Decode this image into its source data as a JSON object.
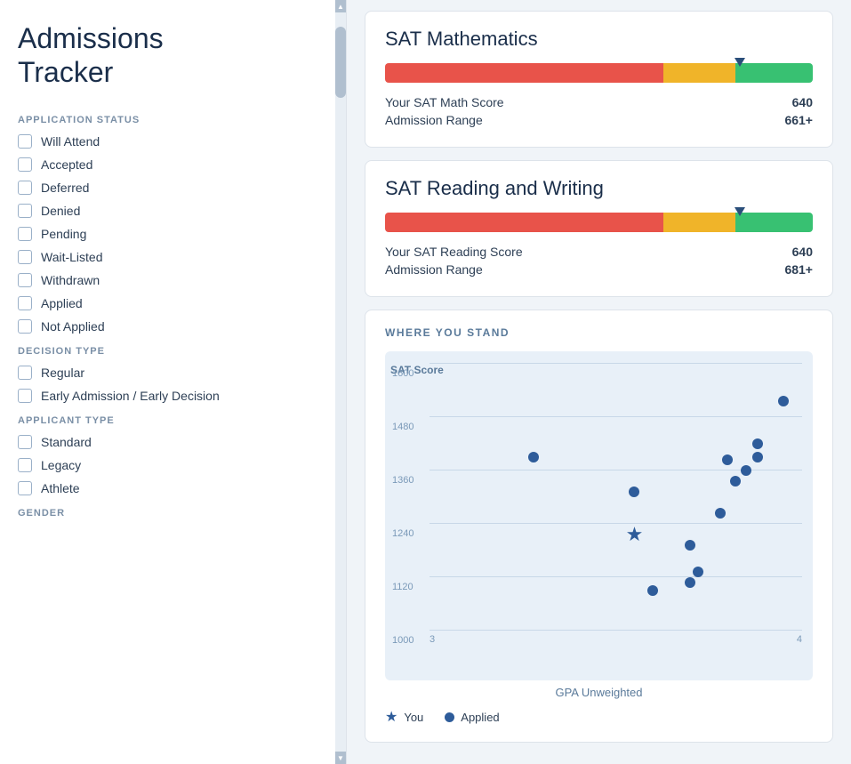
{
  "sidebar": {
    "title": "Admissions\nTracker",
    "sections": [
      {
        "label": "APPLICATION STATUS",
        "items": [
          {
            "id": "will-attend",
            "label": "Will Attend"
          },
          {
            "id": "accepted",
            "label": "Accepted"
          },
          {
            "id": "deferred",
            "label": "Deferred"
          },
          {
            "id": "denied",
            "label": "Denied"
          },
          {
            "id": "pending",
            "label": "Pending"
          },
          {
            "id": "wait-listed",
            "label": "Wait-Listed"
          },
          {
            "id": "withdrawn",
            "label": "Withdrawn"
          },
          {
            "id": "applied",
            "label": "Applied"
          },
          {
            "id": "not-applied",
            "label": "Not Applied"
          }
        ]
      },
      {
        "label": "DECISION TYPE",
        "items": [
          {
            "id": "regular",
            "label": "Regular"
          },
          {
            "id": "early-admission",
            "label": "Early Admission / Early Decision"
          }
        ]
      },
      {
        "label": "APPLICANT TYPE",
        "items": [
          {
            "id": "standard",
            "label": "Standard"
          },
          {
            "id": "legacy",
            "label": "Legacy"
          },
          {
            "id": "athlete",
            "label": "Athlete"
          }
        ]
      },
      {
        "label": "GENDER",
        "items": []
      }
    ]
  },
  "math_section": {
    "title": "SAT Mathematics",
    "bar_red_pct": 65,
    "bar_yellow_pct": 17,
    "bar_green_pct": 18,
    "marker_pct": 83,
    "your_score_label": "Your SAT Math Score",
    "your_score_value": "640",
    "admission_range_label": "Admission Range",
    "admission_range_value": "661+"
  },
  "reading_section": {
    "title": "SAT Reading and Writing",
    "bar_red_pct": 65,
    "bar_yellow_pct": 17,
    "bar_green_pct": 18,
    "marker_pct": 83,
    "your_score_label": "Your SAT Reading Score",
    "your_score_value": "640",
    "admission_range_label": "Admission Range",
    "admission_range_value": "681+"
  },
  "chart": {
    "section_title": "WHERE YOU STAND",
    "y_axis_label": "SAT Score",
    "x_axis_label": "GPA Unweighted",
    "y_ticks": [
      "1600",
      "1480",
      "1360",
      "1240",
      "1120",
      "1000"
    ],
    "x_ticks": [
      "3",
      "",
      "4"
    ],
    "dots": [
      {
        "x_pct": 28,
        "y_pct": 35,
        "type": "applied"
      },
      {
        "x_pct": 55,
        "y_pct": 48,
        "type": "applied"
      },
      {
        "x_pct": 70,
        "y_pct": 68,
        "type": "applied"
      },
      {
        "x_pct": 72,
        "y_pct": 78,
        "type": "applied"
      },
      {
        "x_pct": 80,
        "y_pct": 36,
        "type": "applied"
      },
      {
        "x_pct": 82,
        "y_pct": 44,
        "type": "applied"
      },
      {
        "x_pct": 85,
        "y_pct": 40,
        "type": "applied"
      },
      {
        "x_pct": 88,
        "y_pct": 35,
        "type": "applied"
      },
      {
        "x_pct": 88,
        "y_pct": 30,
        "type": "applied"
      },
      {
        "x_pct": 95,
        "y_pct": 14,
        "type": "applied"
      },
      {
        "x_pct": 70,
        "y_pct": 82,
        "type": "applied"
      },
      {
        "x_pct": 78,
        "y_pct": 56,
        "type": "applied"
      },
      {
        "x_pct": 60,
        "y_pct": 85,
        "type": "applied"
      },
      {
        "x_pct": 55,
        "y_pct": 64,
        "type": "you"
      }
    ],
    "legend_you": "You",
    "legend_applied": "Applied"
  }
}
